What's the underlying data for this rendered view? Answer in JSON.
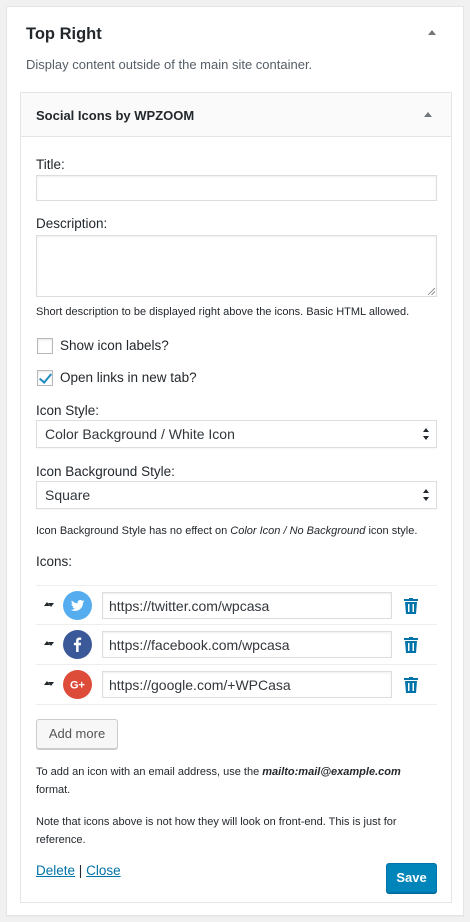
{
  "sidebar": {
    "title": "Top Right",
    "description": "Display content outside of the main site container."
  },
  "widget": {
    "title": "Social Icons by WPZOOM",
    "title_field": {
      "label": "Title:",
      "value": ""
    },
    "description_field": {
      "label": "Description:",
      "value": "",
      "help": "Short description to be displayed right above the icons. Basic HTML allowed."
    },
    "show_labels": {
      "label": "Show icon labels?",
      "checked": false
    },
    "open_new_tab": {
      "label": "Open links in new tab?",
      "checked": true
    },
    "icon_style": {
      "label": "Icon Style:",
      "value": "Color Background / White Icon"
    },
    "icon_bg_style": {
      "label": "Icon Background Style:",
      "value": "Square"
    },
    "note_bg": {
      "part1": "Icon Background Style has no effect on ",
      "em1": "Color Icon / No Background",
      "part2": " icon style."
    },
    "icons_label": "Icons:",
    "icons": [
      {
        "network": "twitter",
        "icon": "twitter-icon",
        "color": "#55acee",
        "url": "https://twitter.com/wpcasa"
      },
      {
        "network": "facebook",
        "icon": "facebook-icon",
        "color": "#3b5998",
        "url": "https://facebook.com/wpcasa"
      },
      {
        "network": "google-plus",
        "icon": "google-plus-icon",
        "color": "#dd4b39",
        "url": "https://google.com/+WPCasa"
      }
    ],
    "add_more_label": "Add more",
    "email_note": {
      "part1": "To add an icon with an email address, use the ",
      "strong": "mailto:mail@example.com",
      "part2": " format."
    },
    "frontend_note": "Note that icons above is not how they will look on front-end. This is just for reference.",
    "delete_label": "Delete",
    "separator": "|",
    "close_label": "Close",
    "save_label": "Save"
  },
  "colors": {
    "accent": "#0085ba",
    "link": "#0073aa",
    "checkmark": "#1e8cbe"
  }
}
